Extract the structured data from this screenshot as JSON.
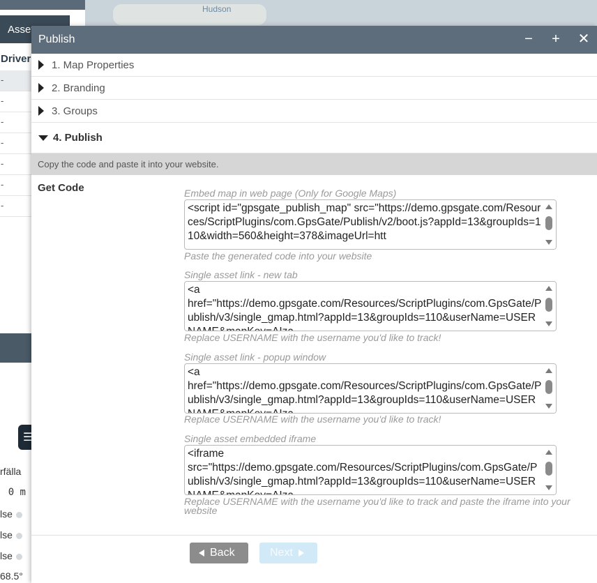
{
  "background": {
    "asset_tab": "Asset",
    "driver_header": "Driver",
    "row_values": [
      "-",
      "-",
      "-",
      "-",
      "-",
      "-",
      "-"
    ],
    "map_label": "Hudson",
    "side_texts": [
      "rfälla",
      "0 m",
      "lse",
      "lse",
      "lse",
      "68.5°"
    ]
  },
  "dialog": {
    "title": "Publish",
    "controls": {
      "minimize": "−",
      "maximize": "+",
      "close": "✕"
    },
    "sections": [
      {
        "label": "1. Map Properties",
        "expanded": false
      },
      {
        "label": "2. Branding",
        "expanded": false
      },
      {
        "label": "3. Groups",
        "expanded": false
      },
      {
        "label": "4. Publish",
        "expanded": true
      }
    ],
    "instruction": "Copy the code and paste it into your website.",
    "get_code_label": "Get Code",
    "fields": [
      {
        "label": "Embed map in web page (Only for Google Maps)",
        "code": "<script id=\"gpsgate_publish_map\" src=\"https://demo.gpsgate.com/Resources/ScriptPlugins/com.GpsGate/Publish/v2/boot.js?appId=13&groupIds=110&width=560&height=378&imageUrl=htt",
        "hint": "Paste the generated code into your website"
      },
      {
        "label": "Single asset link - new tab",
        "code": "<a\nhref=\"https://demo.gpsgate.com/Resources/ScriptPlugins/com.GpsGate/Publish/v3/single_gmap.html?appId=13&groupIds=110&userName=USERNAME&mapKey=AIza",
        "hint": "Replace USERNAME with the username you'd like to track!"
      },
      {
        "label": "Single asset link - popup window",
        "code": "<a\nhref=\"https://demo.gpsgate.com/Resources/ScriptPlugins/com.GpsGate/Publish/v3/single_gmap.html?appId=13&groupIds=110&userName=USERNAME&mapKey=AIza",
        "hint": "Replace USERNAME with the username you'd like to track!"
      },
      {
        "label": "Single asset embedded iframe",
        "code": "<iframe\nsrc=\"https://demo.gpsgate.com/Resources/ScriptPlugins/com.GpsGate/Publish/v3/single_gmap.html?appId=13&groupIds=110&userName=USERNAME&mapKey=AIza",
        "hint": "Replace USERNAME with the username you'd like to track and paste the iframe into your website"
      }
    ],
    "buttons": {
      "back": "Back",
      "next": "Next"
    }
  }
}
